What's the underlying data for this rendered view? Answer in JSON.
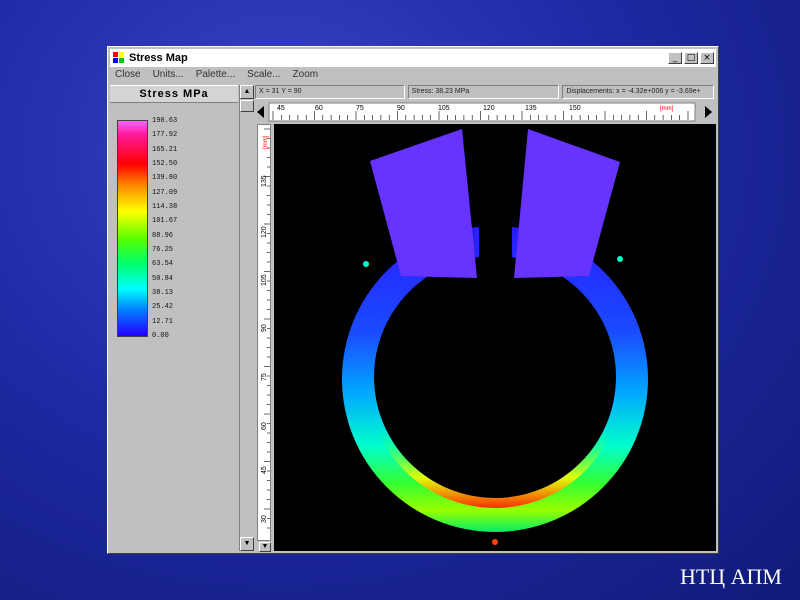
{
  "window": {
    "title": "Stress Map"
  },
  "menu": [
    "Close",
    "Units...",
    "Palette...",
    "Scale...",
    "Zoom"
  ],
  "window_buttons": {
    "minimize": "_",
    "maximize": "□",
    "close": "×"
  },
  "legend": {
    "title": "Stress  MPa",
    "ticks": [
      "190.63",
      "177.92",
      "165.21",
      "152.50",
      "139.80",
      "127.09",
      "114.38",
      "101.67",
      "88.96",
      "76.25",
      "63.54",
      "50.84",
      "38.13",
      "25.42",
      "12.71",
      "0.00"
    ]
  },
  "status": {
    "coords": "X = 31  Y = 90",
    "stress": "Stress: 38.23 MPa",
    "displacements": "Displacements: x = -4.32e+006  y = -3.69e+"
  },
  "hruler": {
    "ticks": [
      "45",
      "60",
      "75",
      "90",
      "105",
      "120",
      "135",
      "150"
    ],
    "unit": "[mm]"
  },
  "vruler": {
    "ticks": [
      "135",
      "120",
      "105",
      "90",
      "75",
      "60",
      "45",
      "30"
    ],
    "unit": "[mm]"
  },
  "colors": {
    "accent": "#ff0000",
    "hot": "#ff0000",
    "cold": "#2200ff",
    "part": "#6633ff"
  },
  "brand": "НТЦ АПМ"
}
